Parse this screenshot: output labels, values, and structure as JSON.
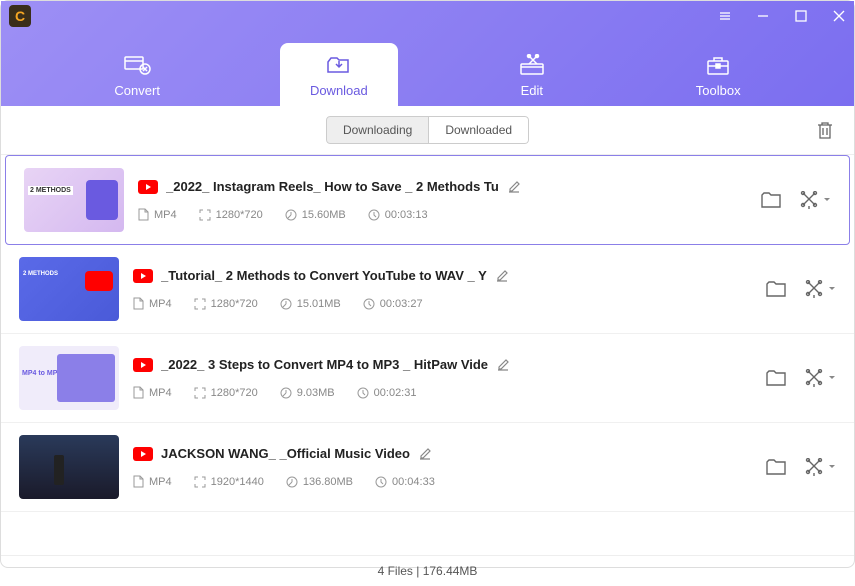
{
  "tabs": {
    "convert": "Convert",
    "download": "Download",
    "edit": "Edit",
    "toolbox": "Toolbox"
  },
  "segments": {
    "downloading": "Downloading",
    "downloaded": "Downloaded"
  },
  "items": [
    {
      "title": "_2022_ Instagram Reels_ How to Save _ 2 Methods Tu",
      "format": "MP4",
      "resolution": "1280*720",
      "size": "15.60MB",
      "duration": "00:03:13",
      "selected": true
    },
    {
      "title": "_Tutorial_ 2 Methods to Convert YouTube to WAV _ Y",
      "format": "MP4",
      "resolution": "1280*720",
      "size": "15.01MB",
      "duration": "00:03:27",
      "selected": false
    },
    {
      "title": "_2022_ 3 Steps to Convert MP4 to MP3 _ HitPaw Vide",
      "format": "MP4",
      "resolution": "1280*720",
      "size": "9.03MB",
      "duration": "00:02:31",
      "selected": false
    },
    {
      "title": "JACKSON WANG_ _Official Music Video",
      "format": "MP4",
      "resolution": "1920*1440",
      "size": "136.80MB",
      "duration": "00:04:33",
      "selected": false
    }
  ],
  "footer": "4 Files | 176.44MB"
}
